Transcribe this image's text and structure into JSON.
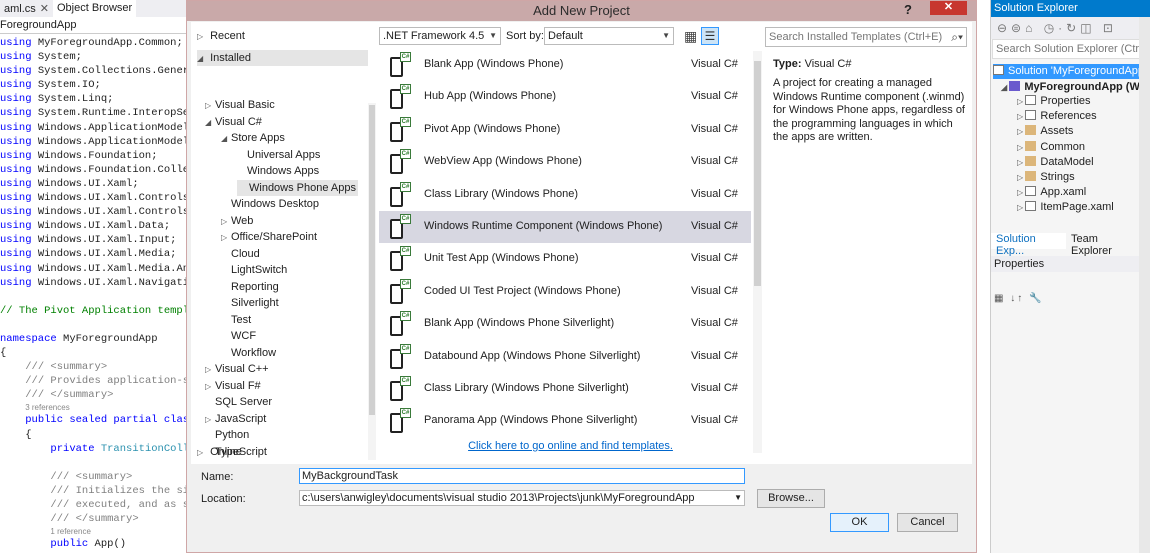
{
  "editor": {
    "tabs": [
      {
        "label": "aml.cs",
        "close": "✕"
      },
      {
        "label": "Object Browser",
        "close": ""
      }
    ],
    "path": "ForegroundApp",
    "lines": [
      {
        "kw": "using",
        "rest": " MyForegroundApp.Common;"
      },
      {
        "kw": "using",
        "rest": " System;"
      },
      {
        "kw": "using",
        "rest": " System.Collections.Generi"
      },
      {
        "kw": "using",
        "rest": " System.IO;"
      },
      {
        "kw": "using",
        "rest": " System.Linq;"
      },
      {
        "kw": "using",
        "rest": " System.Runtime.InteropSer"
      },
      {
        "kw": "using",
        "rest": " Windows.ApplicationModel;"
      },
      {
        "kw": "using",
        "rest": " Windows.ApplicationModel."
      },
      {
        "kw": "using",
        "rest": " Windows.Foundation;"
      },
      {
        "kw": "using",
        "rest": " Windows.Foundation.Collec"
      },
      {
        "kw": "using",
        "rest": " Windows.UI.Xaml;"
      },
      {
        "kw": "using",
        "rest": " Windows.UI.Xaml.Controls;"
      },
      {
        "kw": "using",
        "rest": " Windows.UI.Xaml.Controls."
      },
      {
        "kw": "using",
        "rest": " Windows.UI.Xaml.Data;"
      },
      {
        "kw": "using",
        "rest": " Windows.UI.Xaml.Input;"
      },
      {
        "kw": "using",
        "rest": " Windows.UI.Xaml.Media;"
      },
      {
        "kw": "using",
        "rest": " Windows.UI.Xaml.Media.Ani"
      },
      {
        "kw": "using",
        "rest": " Windows.UI.Xaml.Navigati"
      }
    ],
    "comment_pivot": "// The Pivot Application templa",
    "namespace_kw": "namespace",
    "namespace_name": " MyForegroundApp",
    "brace_open": "{",
    "summary1": "/// <summary>",
    "summary2": "/// Provides application-sp",
    "summary3": "/// </summary>",
    "refs3": "3 references",
    "class_kw": "public sealed partial class",
    "brace_inner": "{",
    "private_kw": "private",
    "private_type": " TransitionColle",
    "summary4": "/// <summary>",
    "summary5": "/// Initializes the sin",
    "summary6": "/// executed, and as su",
    "summary7": "/// </summary>",
    "refs1": "1 reference",
    "app_ctor_kw": "public",
    "app_ctor": " App()"
  },
  "dialog": {
    "title": "Add New Project",
    "help": "?",
    "close": "✕",
    "tree": {
      "recent": "Recent",
      "installed": "Installed",
      "items": [
        {
          "label": "Visual Basic",
          "expander": "▷",
          "indent": 0
        },
        {
          "label": "Visual C#",
          "expander": "◢",
          "indent": 0
        },
        {
          "label": "Store Apps",
          "expander": "◢",
          "indent": 1
        },
        {
          "label": "Universal Apps",
          "expander": "",
          "indent": 2
        },
        {
          "label": "Windows Apps",
          "expander": "",
          "indent": 2
        },
        {
          "label": "Windows Phone Apps",
          "expander": "",
          "indent": 2,
          "selected": true
        },
        {
          "label": "Windows Desktop",
          "expander": "",
          "indent": 1
        },
        {
          "label": "Web",
          "expander": "▷",
          "indent": 1
        },
        {
          "label": "Office/SharePoint",
          "expander": "▷",
          "indent": 1
        },
        {
          "label": "Cloud",
          "expander": "",
          "indent": 1
        },
        {
          "label": "LightSwitch",
          "expander": "",
          "indent": 1
        },
        {
          "label": "Reporting",
          "expander": "",
          "indent": 1
        },
        {
          "label": "Silverlight",
          "expander": "",
          "indent": 1
        },
        {
          "label": "Test",
          "expander": "",
          "indent": 1
        },
        {
          "label": "WCF",
          "expander": "",
          "indent": 1
        },
        {
          "label": "Workflow",
          "expander": "",
          "indent": 1
        },
        {
          "label": "Visual C++",
          "expander": "▷",
          "indent": 0
        },
        {
          "label": "Visual F#",
          "expander": "▷",
          "indent": 0
        },
        {
          "label": "SQL Server",
          "expander": "",
          "indent": 0
        },
        {
          "label": "JavaScript",
          "expander": "▷",
          "indent": 0
        },
        {
          "label": "Python",
          "expander": "",
          "indent": 0
        },
        {
          "label": "TypeScript",
          "expander": "",
          "indent": 0
        }
      ],
      "online": "Online"
    },
    "framework": ".NET Framework 4.5",
    "sort_by_label": "Sort by:",
    "sort_by_value": "Default",
    "templates": [
      {
        "name": "Blank App (Windows Phone)",
        "lang": "Visual C#"
      },
      {
        "name": "Hub App (Windows Phone)",
        "lang": "Visual C#"
      },
      {
        "name": "Pivot App (Windows Phone)",
        "lang": "Visual C#"
      },
      {
        "name": "WebView App (Windows Phone)",
        "lang": "Visual C#"
      },
      {
        "name": "Class Library (Windows Phone)",
        "lang": "Visual C#"
      },
      {
        "name": "Windows Runtime Component (Windows Phone)",
        "lang": "Visual C#",
        "selected": true
      },
      {
        "name": "Unit Test App (Windows Phone)",
        "lang": "Visual C#"
      },
      {
        "name": "Coded UI Test Project (Windows Phone)",
        "lang": "Visual C#"
      },
      {
        "name": "Blank App (Windows Phone Silverlight)",
        "lang": "Visual C#"
      },
      {
        "name": "Databound App (Windows Phone Silverlight)",
        "lang": "Visual C#"
      },
      {
        "name": "Class Library (Windows Phone Silverlight)",
        "lang": "Visual C#"
      },
      {
        "name": "Panorama App (Windows Phone Silverlight)",
        "lang": "Visual C#"
      }
    ],
    "online_link": "Click here to go online and find templates.",
    "search_placeholder": "Search Installed Templates (Ctrl+E)",
    "type_label": "Type:",
    "type_value": "Visual C#",
    "description": "A project for creating a managed Windows Runtime component (.winmd) for Windows Phone apps, regardless of the programming languages in which the apps are written.",
    "name_label": "Name:",
    "name_value": "MyBackgroundTask",
    "location_label": "Location:",
    "location_value": "c:\\users\\anwigley\\documents\\visual studio 2013\\Projects\\junk\\MyForegroundApp",
    "browse": "Browse...",
    "ok": "OK",
    "cancel": "Cancel"
  },
  "solution_explorer": {
    "title": "Solution Explorer",
    "search_placeholder": "Search Solution Explorer (Ctrl+;)",
    "solution": "Solution 'MyForegroundApp",
    "project": "MyForegroundApp (W",
    "items": [
      "Properties",
      "References",
      "Assets",
      "Common",
      "DataModel",
      "Strings",
      "App.xaml",
      "ItemPage.xaml"
    ],
    "tabs": [
      "Solution Exp...",
      "Team Explorer"
    ],
    "properties_title": "Properties"
  }
}
